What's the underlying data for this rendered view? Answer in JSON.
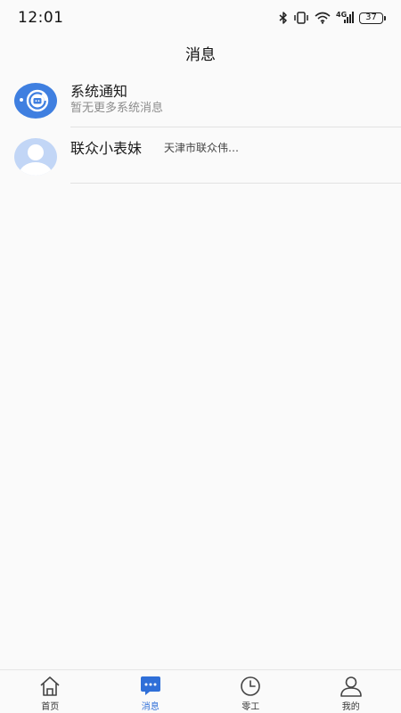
{
  "status_bar": {
    "time": "12:01",
    "battery": "37",
    "network_label": "4G"
  },
  "header": {
    "title": "消息"
  },
  "messages": [
    {
      "title": "系统通知",
      "subtitle": "暂无更多系统消息",
      "avatar": "system-notify-icon"
    },
    {
      "title": "联众小表妹",
      "preview": "天津市联众伟…",
      "avatar": "default-avatar-icon"
    }
  ],
  "bottom_nav": {
    "items": [
      {
        "label": "首页",
        "icon": "home-icon",
        "active": false
      },
      {
        "label": "消息",
        "icon": "chat-icon",
        "active": true
      },
      {
        "label": "零工",
        "icon": "clock-icon",
        "active": false
      },
      {
        "label": "我的",
        "icon": "profile-icon",
        "active": false
      }
    ]
  },
  "colors": {
    "accent": "#2f6fd8",
    "background": "#fafafa",
    "divider": "#e2e2e2",
    "subtitle": "#8c8c8c"
  }
}
